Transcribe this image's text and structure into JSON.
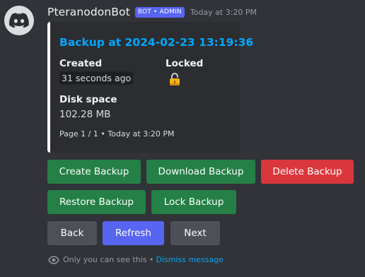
{
  "message": {
    "username": "PteranodonBot",
    "bot_tag": "BOT • ADMIN",
    "timestamp": "Today at 3:20 PM",
    "avatar_icon": "discord-logo-icon"
  },
  "embed": {
    "accent_color": "#ffffff",
    "title": "Backup at 2024-02-23 13:19:36",
    "fields": {
      "created": {
        "name": "Created",
        "value": "31 seconds ago"
      },
      "locked": {
        "name": "Locked",
        "icon": "unlocked-padlock-icon"
      },
      "disk_space": {
        "name": "Disk space",
        "value": "102.28 MB"
      }
    },
    "footer": "Page 1 / 1 • Today at 3:20 PM"
  },
  "buttons": {
    "create_backup": "Create Backup",
    "download_backup": "Download Backup",
    "delete_backup": "Delete Backup",
    "restore_backup": "Restore Backup",
    "lock_backup": "Lock Backup",
    "back": "Back",
    "refresh": "Refresh",
    "next": "Next"
  },
  "ephemeral": {
    "icon": "eye-icon",
    "note": "Only you can see this •",
    "dismiss_label": "Dismiss message"
  },
  "colors": {
    "background": "#313338",
    "embed_background": "#2b2d31",
    "link": "#00a8fc",
    "success": "#248046",
    "danger": "#da373c",
    "secondary": "#4e5058",
    "primary": "#5865f2"
  }
}
